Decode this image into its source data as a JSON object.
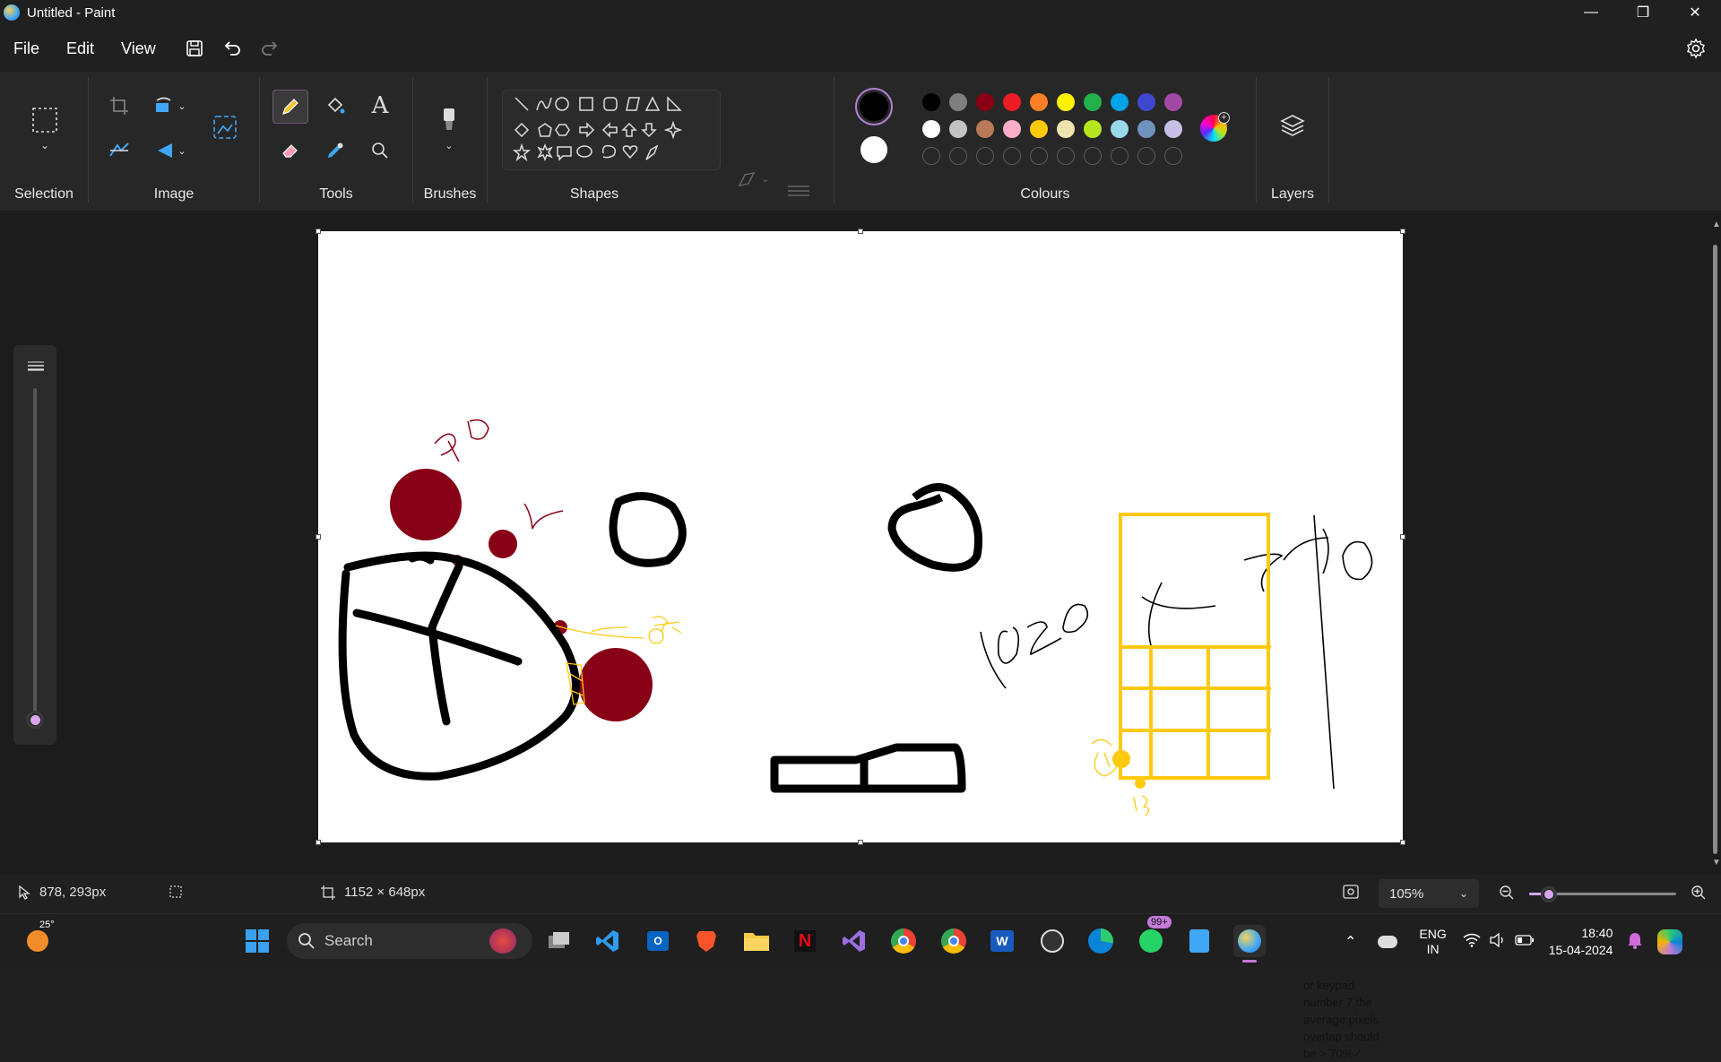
{
  "window": {
    "title": "Untitled - Paint"
  },
  "menu": {
    "file": "File",
    "edit": "Edit",
    "view": "View"
  },
  "ribbon": {
    "selection_label": "Selection",
    "image_label": "Image",
    "tools_label": "Tools",
    "brushes_label": "Brushes",
    "shapes_label": "Shapes",
    "colours_label": "Colours",
    "layers_label": "Layers"
  },
  "colours": {
    "primary": "#000000",
    "secondary": "#ffffff",
    "row1": [
      "#000000",
      "#7f7f7f",
      "#880015",
      "#ed1c24",
      "#ff7f27",
      "#fff200",
      "#22b14c",
      "#00a2e8",
      "#3f48cc",
      "#a349a4"
    ],
    "row2": [
      "#ffffff",
      "#c3c3c3",
      "#b97a57",
      "#ffaec9",
      "#ffc90e",
      "#efe4b0",
      "#b5e61d",
      "#99d9ea",
      "#7092be",
      "#c8bfe7"
    ]
  },
  "canvas": {
    "note": "or keypad number 7 the average pixels overlap should be > 70%✓"
  },
  "status": {
    "cursor_position": "878, 293px",
    "canvas_size": "1152 × 648px",
    "zoom": "105%"
  },
  "taskbar": {
    "weather_temp": "25°",
    "search_label": "Search",
    "whatsapp_badge": "99+",
    "language": "ENG",
    "region": "IN",
    "time": "18:40",
    "date": "15-04-2024"
  }
}
